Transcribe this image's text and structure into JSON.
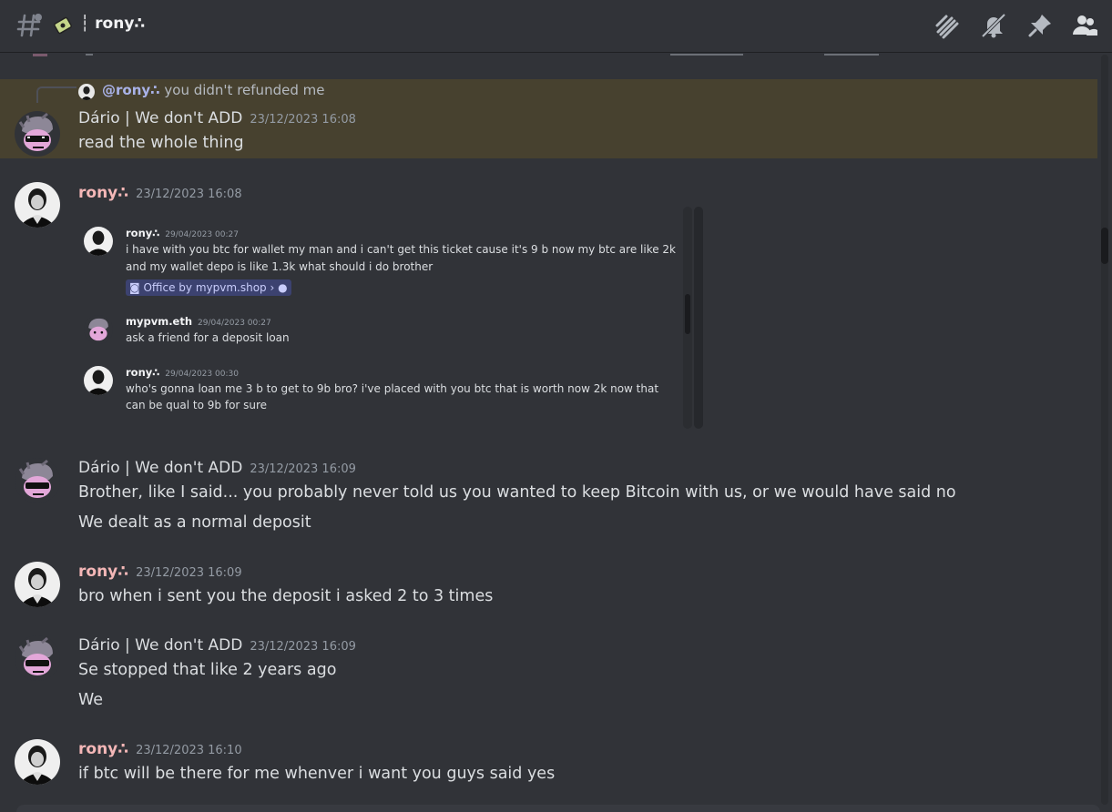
{
  "channel": {
    "emoji": "icon",
    "separator": "┆",
    "name": "rony∴"
  },
  "toolbar": {
    "threads": "threads-icon",
    "mute": "bell-slash-icon",
    "pin": "pin-icon",
    "members": "members-icon"
  },
  "reply": {
    "mention": "@rony∴",
    "text": "you didn't refunded me"
  },
  "messages": [
    {
      "author": "Dário | We don't ADD",
      "ts": "23/12/2023 16:08",
      "lines": [
        "read the whole thing"
      ]
    },
    {
      "author": "rony∴",
      "ts": "23/12/2023 16:08",
      "lines": []
    },
    {
      "author": "Dário | We don't ADD",
      "ts": "23/12/2023 16:09",
      "lines": [
        "Brother, like I said... you probably never told us you wanted to keep Bitcoin with us, or we would have said no",
        "We dealt as a normal deposit"
      ]
    },
    {
      "author": "rony∴",
      "ts": "23/12/2023 16:09",
      "lines": [
        "bro when i sent you the deposit i asked 2 to 3 times"
      ]
    },
    {
      "author": "Dário | We don't ADD",
      "ts": "23/12/2023 16:09",
      "lines": [
        "Se stopped that like 2 years ago",
        "We"
      ]
    },
    {
      "author": "rony∴",
      "ts": "23/12/2023 16:10",
      "lines": [
        "if btc will be there for me whenver i want you guys said yes"
      ]
    }
  ],
  "embed": {
    "items": [
      {
        "author": "rony∴",
        "ts": "29/04/2023 00:27",
        "lines": [
          "i have with you btc for wallet my man and i can't get this ticket cause it's 9 b now my btc are like 2k",
          "and my wallet depo is like 1.3k what should i do brother"
        ],
        "link": "Office by mypvm.shop"
      },
      {
        "author": "mypvm.eth",
        "ts": "29/04/2023 00:27",
        "lines": [
          "ask a friend for a deposit loan"
        ]
      },
      {
        "author": "rony∴",
        "ts": "29/04/2023 00:30",
        "lines": [
          "who's gonna loan me  3 b to get to 9b bro? i've placed with you btc that is worth now 2k now that",
          "can be qual to 9b for sure"
        ]
      }
    ]
  }
}
